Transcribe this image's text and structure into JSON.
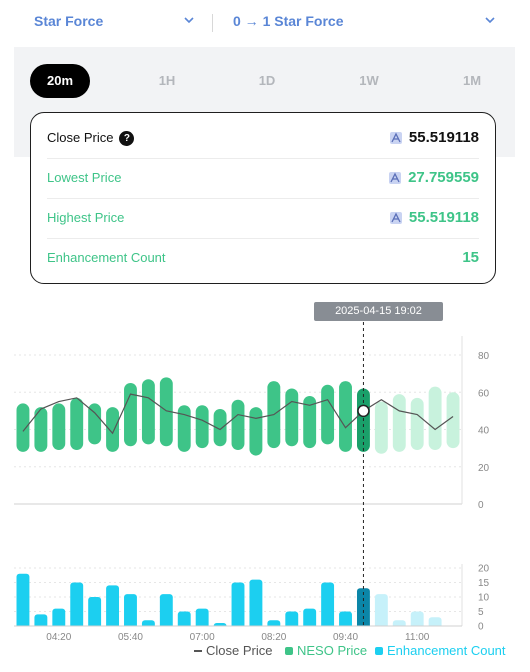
{
  "selectors": {
    "left": "Star Force",
    "right": "0 → 1 Star Force"
  },
  "periods": [
    "20m",
    "1H",
    "1D",
    "1W",
    "1M"
  ],
  "active_period": "20m",
  "card": {
    "close_label": "Close Price",
    "close_value": "55.519118",
    "lowest_label": "Lowest Price",
    "lowest_value": "27.759559",
    "highest_label": "Highest Price",
    "highest_value": "55.519118",
    "count_label": "Enhancement Count",
    "count_value": "15"
  },
  "tooltip": "2025-04-15 19:02",
  "colors": {
    "accent_blue": "#5a86d6",
    "green": "#3ec488",
    "green_dark": "#1aa06a",
    "green_light": "#c8f2dd",
    "cyan": "#1ccff0",
    "cyan_dark": "#0b86a8",
    "cyan_light": "#c6f1fa"
  },
  "legend": {
    "close": "Close Price",
    "neso": "NESO Price",
    "count": "Enhancement Count"
  },
  "chart_data": {
    "type": "bar",
    "x_ticks": [
      "04:20",
      "05:40",
      "07:00",
      "08:20",
      "09:40",
      "11:00"
    ],
    "price_axis": {
      "ticks": [
        0,
        20,
        40,
        60,
        80
      ],
      "ylim": [
        0,
        80
      ]
    },
    "count_axis": {
      "ticks": [
        0,
        5,
        10,
        15,
        20
      ],
      "ylim": [
        0,
        20
      ]
    },
    "selected_index": 19,
    "series": [
      {
        "name": "NESO Price",
        "kind": "range-bar",
        "low": [
          28,
          28,
          29,
          29,
          32,
          28,
          31,
          32,
          31,
          28,
          30,
          31,
          29,
          26,
          30,
          31,
          30,
          32,
          28,
          28,
          27,
          28,
          29,
          29,
          30
        ],
        "high": [
          54,
          52,
          54,
          57,
          54,
          52,
          65,
          67,
          68,
          53,
          53,
          51,
          56,
          52,
          66,
          62,
          58,
          64,
          66,
          62,
          55,
          59,
          57,
          63,
          60
        ]
      },
      {
        "name": "Close Price",
        "kind": "line",
        "values": [
          39,
          51,
          55,
          57,
          49,
          38,
          59,
          57,
          50,
          48,
          45,
          40,
          48,
          46,
          48,
          55,
          53,
          56,
          41,
          50,
          56,
          50,
          48,
          40,
          47
        ]
      },
      {
        "name": "Enhancement Count",
        "kind": "bar",
        "values": [
          18,
          4,
          6,
          15,
          10,
          14,
          11,
          2,
          11,
          5,
          6,
          1,
          15,
          16,
          2,
          5,
          6,
          15,
          5,
          13,
          11,
          2,
          5,
          3,
          0
        ]
      }
    ]
  }
}
